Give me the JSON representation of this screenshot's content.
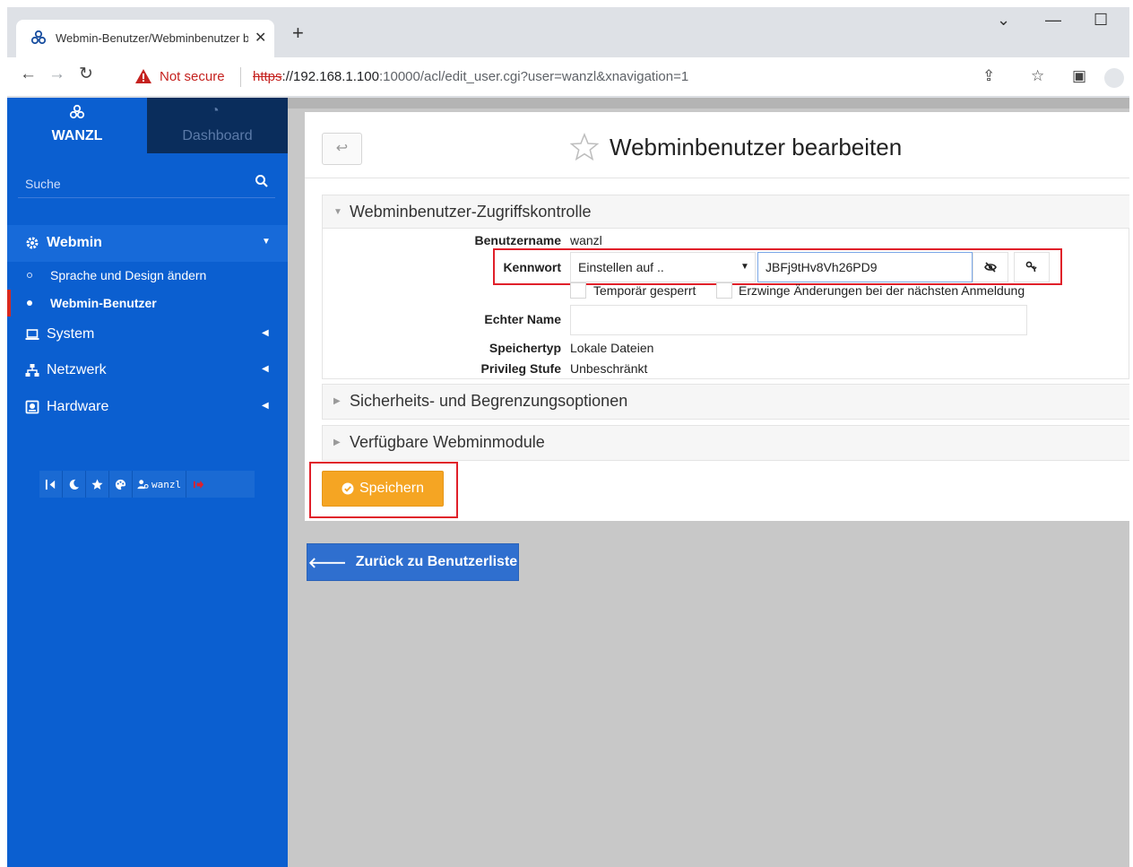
{
  "browser": {
    "tab_title": "Webmin-Benutzer/Webminbenutzer bearbeiten",
    "tab_close": "✕",
    "new_tab": "+",
    "security_label": "Not secure",
    "url_scheme": "https",
    "url_rest_host": "://192.168.1.100",
    "url_rest_path": ":10000/acl/edit_user.cgi?user=wanzl&xnavigation=1"
  },
  "sidebar": {
    "brand_label": "WANZL",
    "dashboard_label": "Dashboard",
    "search_placeholder": "Suche",
    "items": [
      {
        "label": "Webmin"
      },
      {
        "label": "System"
      },
      {
        "label": "Netzwerk"
      },
      {
        "label": "Hardware"
      }
    ],
    "sub_items": [
      {
        "label": "Sprache und Design ändern"
      },
      {
        "label": "Webmin-Benutzer"
      }
    ],
    "toolbar_user": "wanzl"
  },
  "page": {
    "title": "Webminbenutzer bearbeiten",
    "section_access": "Webminbenutzer-Zugriffskontrolle",
    "section_security": "Sicherheits- und Begrenzungsoptionen",
    "section_modules": "Verfügbare Webminmodule",
    "form": {
      "username_label": "Benutzername",
      "username_value": "wanzl",
      "password_label": "Kennwort",
      "password_mode": "Einstellen auf ..",
      "password_value": "JBFj9tHv8Vh26PD9",
      "locked_label": "Temporär gesperrt",
      "force_change_label": "Erzwinge Änderungen bei der nächsten Anmeldung",
      "realname_label": "Echter Name",
      "realname_value": "",
      "storage_label": "Speichertyp",
      "storage_value": "Lokale Dateien",
      "privilege_label": "Privileg Stufe",
      "privilege_value": "Unbeschränkt"
    },
    "save_label": "Speichern",
    "return_label": "Zurück zu Benutzerliste"
  },
  "colors": {
    "sidebar": "#0b5fd0",
    "sidebar_dark": "#0a2d5c",
    "save": "#f5a523",
    "return": "#2f6fcf",
    "highlight": "#e0202a"
  }
}
